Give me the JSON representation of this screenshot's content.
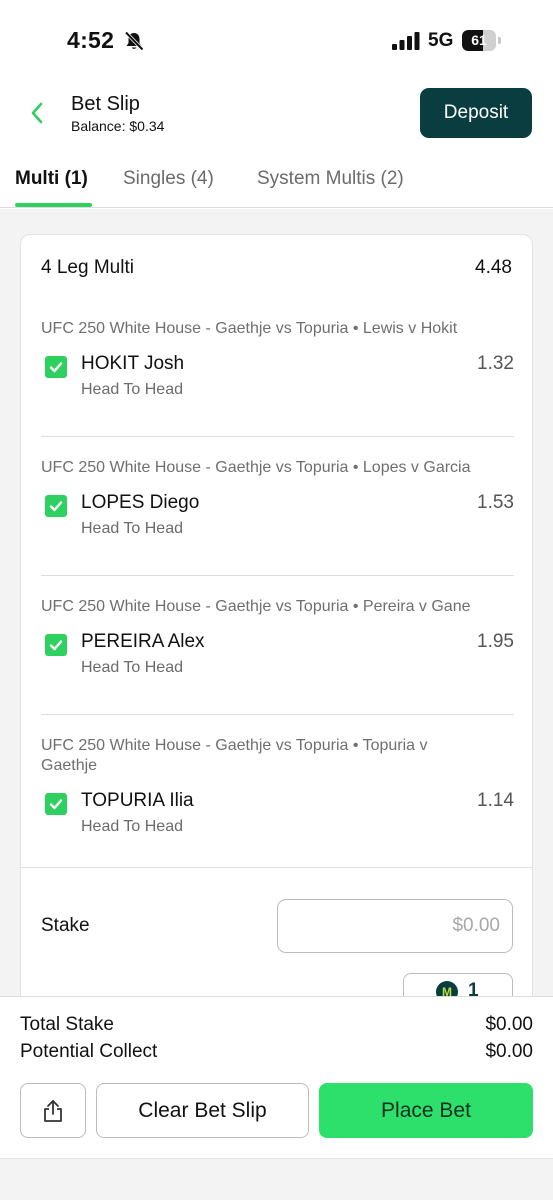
{
  "status_bar": {
    "time": "4:52",
    "network": "5G",
    "battery": "61",
    "battery_level": 0.61
  },
  "header": {
    "title": "Bet Slip",
    "balance": "Balance: $0.34",
    "deposit_label": "Deposit"
  },
  "tabs": [
    {
      "label": "Multi (1)",
      "active": true
    },
    {
      "label": "Singles (4)",
      "active": false
    },
    {
      "label": "System Multis (2)",
      "active": false
    }
  ],
  "multi": {
    "title": "4 Leg Multi",
    "odds": "4.48",
    "legs": [
      {
        "event": "UFC 250 White House - Gaethje vs Topuria • Lewis v Hokit",
        "selection": "HOKIT Josh",
        "market": "Head To Head",
        "odds": "1.32",
        "checked": true
      },
      {
        "event": "UFC 250 White House - Gaethje vs Topuria • Lopes v Garcia",
        "selection": "LOPES Diego",
        "market": "Head To Head",
        "odds": "1.53",
        "checked": true
      },
      {
        "event": "UFC 250 White House - Gaethje vs Topuria • Pereira v Gane",
        "selection": "PEREIRA Alex",
        "market": "Head To Head",
        "odds": "1.95",
        "checked": true
      },
      {
        "event": "UFC 250 White House - Gaethje vs Topuria • Topuria v Gaethje",
        "selection": "TOPURIA Ilia",
        "market": "Head To Head",
        "odds": "1.14",
        "checked": true
      }
    ],
    "stake_label": "Stake",
    "stake_placeholder": "$0.00",
    "bonus_count": "1"
  },
  "footer": {
    "total_stake_label": "Total Stake",
    "total_stake_value": "$0.00",
    "potential_collect_label": "Potential Collect",
    "potential_collect_value": "$0.00",
    "clear_label": "Clear Bet Slip",
    "place_label": "Place Bet"
  },
  "colors": {
    "accent_green": "#2ed15f",
    "deposit_bg": "#0a3d3f",
    "place_bet_bg": "#2de06b"
  },
  "icons": [
    "bell-slash-icon",
    "signal-icon",
    "battery-icon",
    "chevron-left-icon",
    "checkmark-icon",
    "bonus-icon",
    "share-icon"
  ]
}
